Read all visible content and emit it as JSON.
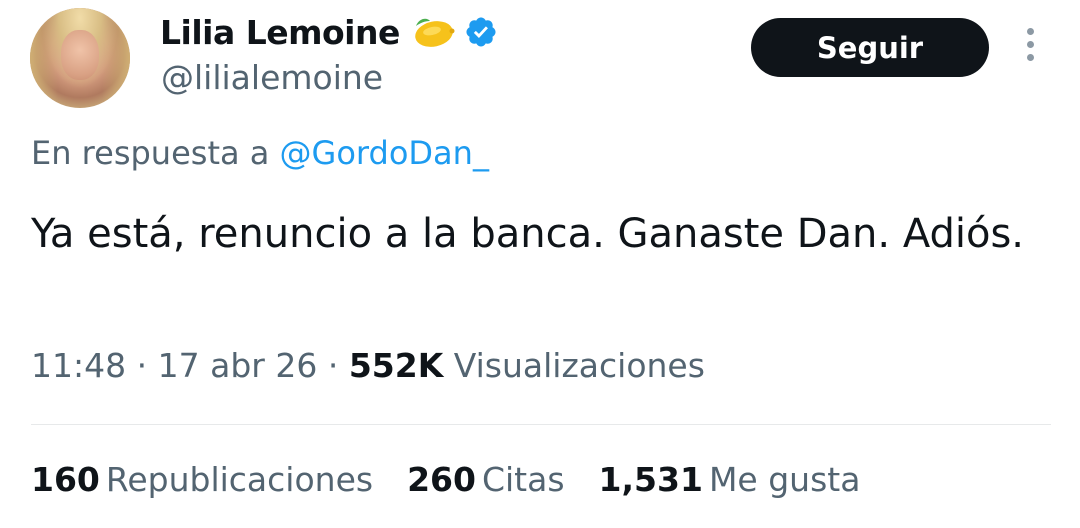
{
  "author": {
    "display_name": "Lilia Lemoine",
    "handle": "@lilialemoine",
    "emoji": "lemon",
    "verified_icon": "verified-badge-icon",
    "verified_color": "#1d9bf0"
  },
  "follow_button": {
    "label": "Seguir"
  },
  "reply": {
    "prefix": "En respuesta a",
    "mention": "@GordoDan_"
  },
  "tweet": {
    "text": "Ya está, renuncio a la banca. Ganaste Dan. Adiós."
  },
  "meta": {
    "time": "11:48",
    "separator": "·",
    "date": "17 abr 26",
    "views_count": "552K",
    "views_label": "Visualizaciones"
  },
  "stats": [
    {
      "count": "160",
      "label": "Republicaciones"
    },
    {
      "count": "260",
      "label": "Citas"
    },
    {
      "count": "1,531",
      "label": "Me gusta"
    }
  ],
  "colors": {
    "text_primary": "#0f1419",
    "text_secondary": "#536471",
    "link": "#1d9bf0",
    "button_bg": "#0f1419"
  }
}
